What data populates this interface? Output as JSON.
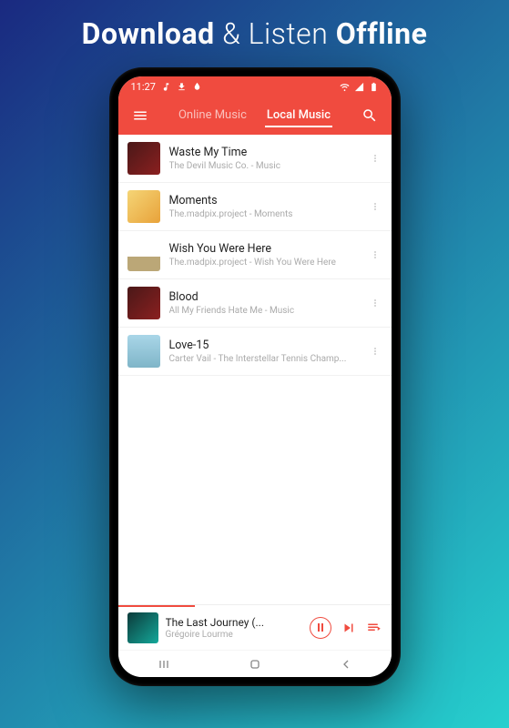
{
  "hero": {
    "part1": "Download",
    "part2": "& Listen",
    "part3": "Offline"
  },
  "status": {
    "time": "11:27"
  },
  "tabs": {
    "online": "Online Music",
    "local": "Local Music"
  },
  "tracks": [
    {
      "title": "Waste My Time",
      "subtitle": "The Devil Music Co. - Music"
    },
    {
      "title": "Moments",
      "subtitle": "The.madpix.project - Moments"
    },
    {
      "title": "Wish You Were Here",
      "subtitle": "The.madpix.project - Wish You Were Here"
    },
    {
      "title": "Blood",
      "subtitle": "All My Friends Hate Me - Music"
    },
    {
      "title": "Love-15",
      "subtitle": "Carter Vail - The Interstellar Tennis Champ..."
    }
  ],
  "nowPlaying": {
    "title": "The Last Journey (...",
    "artist": "Grégoire Lourme"
  }
}
